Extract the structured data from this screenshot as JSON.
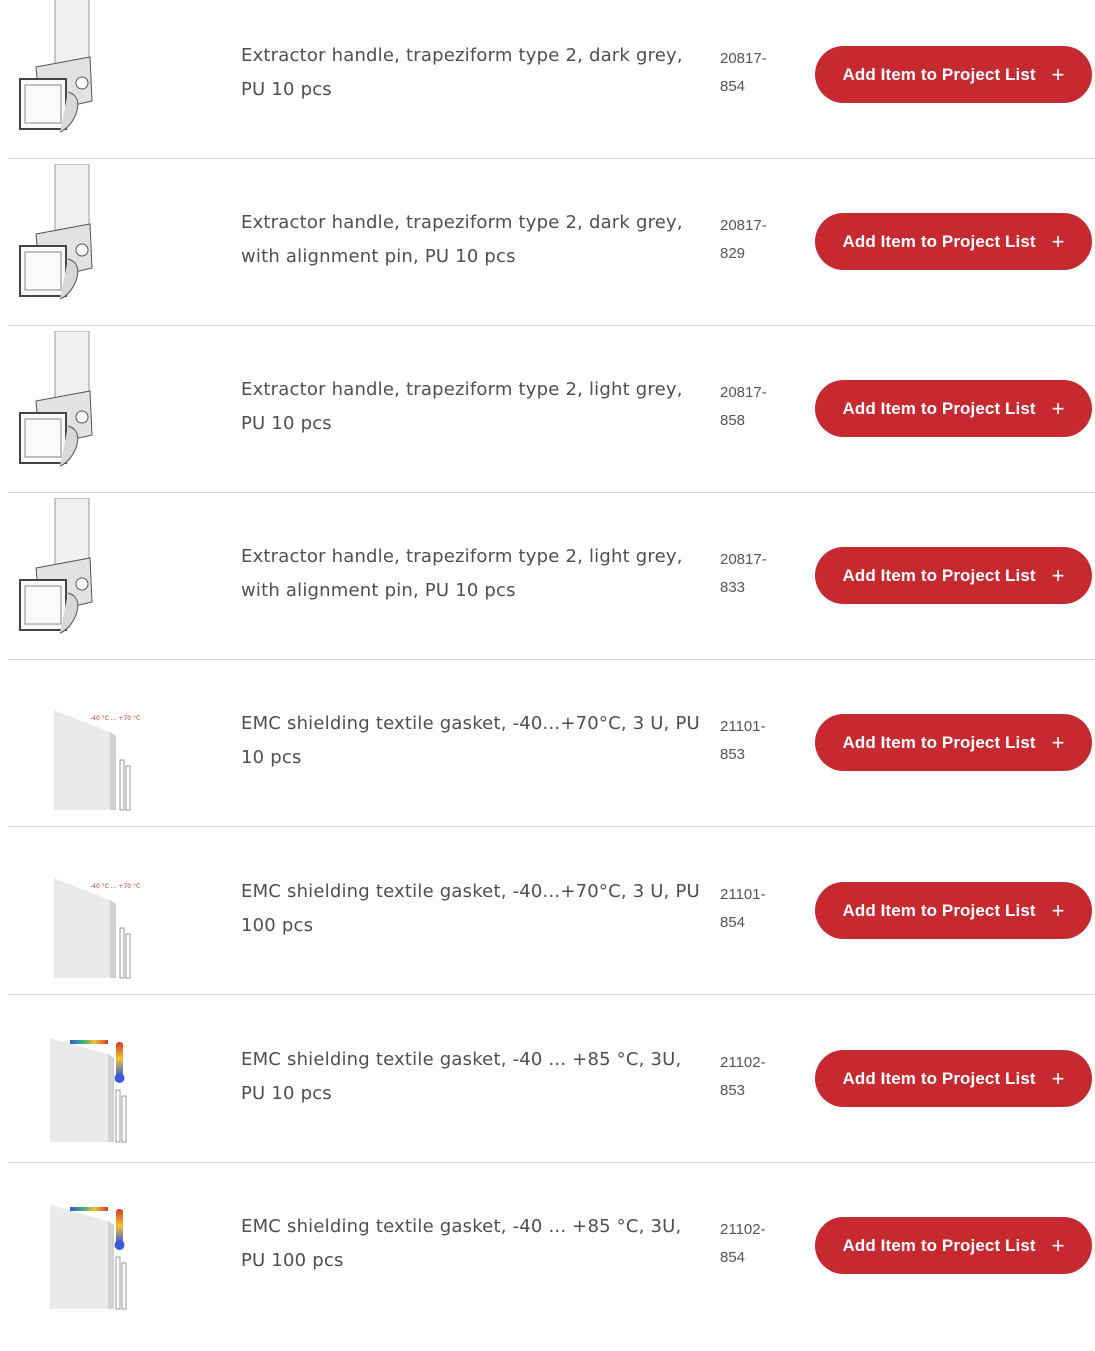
{
  "products": [
    {
      "description": "Extractor handle, trapeziform type 2, dark grey, PU 10 pcs",
      "code": "20817-854",
      "image": "extractor-handle-image",
      "button_label": "Add Item to Project List",
      "button_icon": "+"
    },
    {
      "description": "Extractor handle, trapeziform type 2, dark grey, with alignment pin, PU 10 pcs",
      "code": "20817-829",
      "image": "extractor-handle-image",
      "button_label": "Add Item to Project List",
      "button_icon": "+"
    },
    {
      "description": "Extractor handle, trapeziform type 2, light grey, PU 10 pcs",
      "code": "20817-858",
      "image": "extractor-handle-image",
      "button_label": "Add Item to Project List",
      "button_icon": "+"
    },
    {
      "description": "Extractor handle, trapeziform type 2, light grey, with alignment pin, PU 10 pcs",
      "code": "20817-833",
      "image": "extractor-handle-image",
      "button_label": "Add Item to Project List",
      "button_icon": "+"
    },
    {
      "description": "EMC shielding textile gasket, -40...+70°C, 3 U, PU 10 pcs",
      "code": "21101-853",
      "image": "gasket-image",
      "image_label": "-40 °C ... +70 °C",
      "button_label": "Add Item to Project List",
      "button_icon": "+"
    },
    {
      "description": "EMC shielding textile gasket, -40...+70°C, 3 U, PU 100 pcs",
      "code": "21101-854",
      "image": "gasket-image",
      "image_label": "-40 °C ... +70 °C",
      "button_label": "Add Item to Project List",
      "button_icon": "+"
    },
    {
      "description": "EMC shielding textile gasket, -40 ... +85 °C, 3U, PU 10 pcs",
      "code": "21102-853",
      "image": "gasket-thermometer-image",
      "button_label": "Add Item to Project List",
      "button_icon": "+"
    },
    {
      "description": "EMC shielding textile gasket, -40 ... +85 °C, 3U, PU 100 pcs",
      "code": "21102-854",
      "image": "gasket-thermometer-image",
      "button_label": "Add Item to Project List",
      "button_icon": "+"
    }
  ],
  "colors": {
    "button": "#c62a30",
    "divider": "#d7d7d7",
    "text": "#4f4f4f"
  }
}
